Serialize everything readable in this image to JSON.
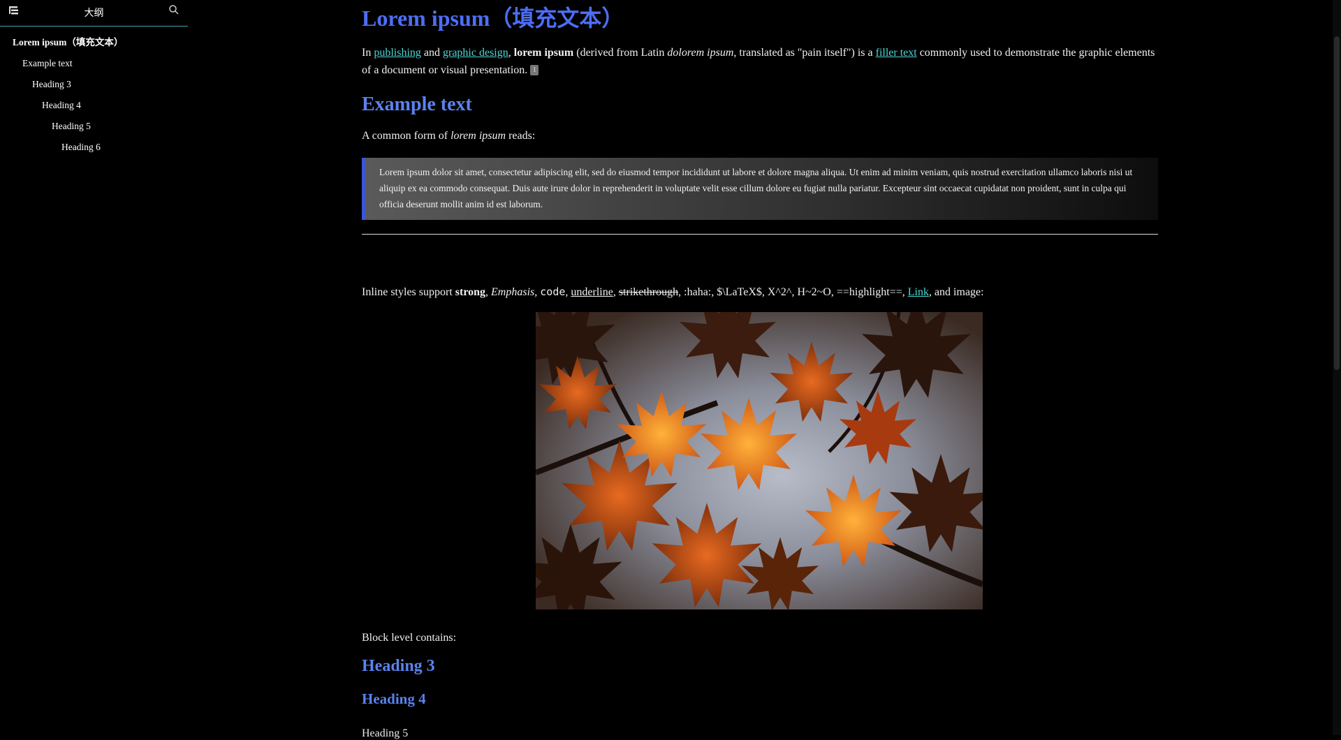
{
  "sidebar": {
    "title": "大纲",
    "menu_icon": "outline-menu-icon",
    "search_icon": "search-icon",
    "items": [
      {
        "label": "Lorem ipsum（填充文本）",
        "level": 1
      },
      {
        "label": "Example text",
        "level": 2
      },
      {
        "label": "Heading 3",
        "level": 3
      },
      {
        "label": "Heading 4",
        "level": 4
      },
      {
        "label": "Heading 5",
        "level": 5
      },
      {
        "label": "Heading 6",
        "level": 6
      }
    ]
  },
  "doc": {
    "title": "Lorem ipsum（填充文本）",
    "intro": {
      "t1": "In ",
      "link1": "publishing",
      "t2": " and ",
      "link2": "graphic design",
      "t3": ", ",
      "bold": "lorem ipsum",
      "t4": " (derived from Latin ",
      "italic": "dolorem ipsum",
      "t5": ", translated as \"pain itself\") is a ",
      "link3": "filler text",
      "t6": " commonly used to demonstrate the graphic elements of a document or visual presentation.",
      "footnote": "1"
    },
    "example_heading": "Example text",
    "common_form": {
      "t1": "A common form of ",
      "italic": "lorem ipsum",
      "t2": " reads:"
    },
    "quote": "Lorem ipsum dolor sit amet, consectetur adipiscing elit, sed do eiusmod tempor incididunt ut labore et dolore magna aliqua. Ut enim ad minim veniam, quis nostrud exercitation ullamco laboris nisi ut aliquip ex ea commodo consequat. Duis aute irure dolor in reprehenderit in voluptate velit esse cillum dolore eu fugiat nulla pariatur. Excepteur sint occaecat cupidatat non proident, sunt in culpa qui officia deserunt mollit anim id est laborum.",
    "inline": {
      "t1": "Inline styles support ",
      "strong": "strong",
      "sep1": ", ",
      "em": "Emphasis",
      "sep2": ", ",
      "code": "code",
      "sep3": ", ",
      "underline": "underline",
      "sep4": ", ",
      "strike": "strikethrough",
      "t2": ", :haha:, $\\LaTeX$, X^2^, H~2~O, ==highlight==, ",
      "link": "Link",
      "t3": ", and image:"
    },
    "block_level": "Block level contains:",
    "h3": "Heading 3",
    "h4": "Heading 4",
    "h5_cut": "Heading 5"
  },
  "colors": {
    "heading": "#4d6ef5",
    "link": "#4ad8d4",
    "quote_border": "#3a57d8",
    "sidebar_rule": "#3fa7b5"
  }
}
